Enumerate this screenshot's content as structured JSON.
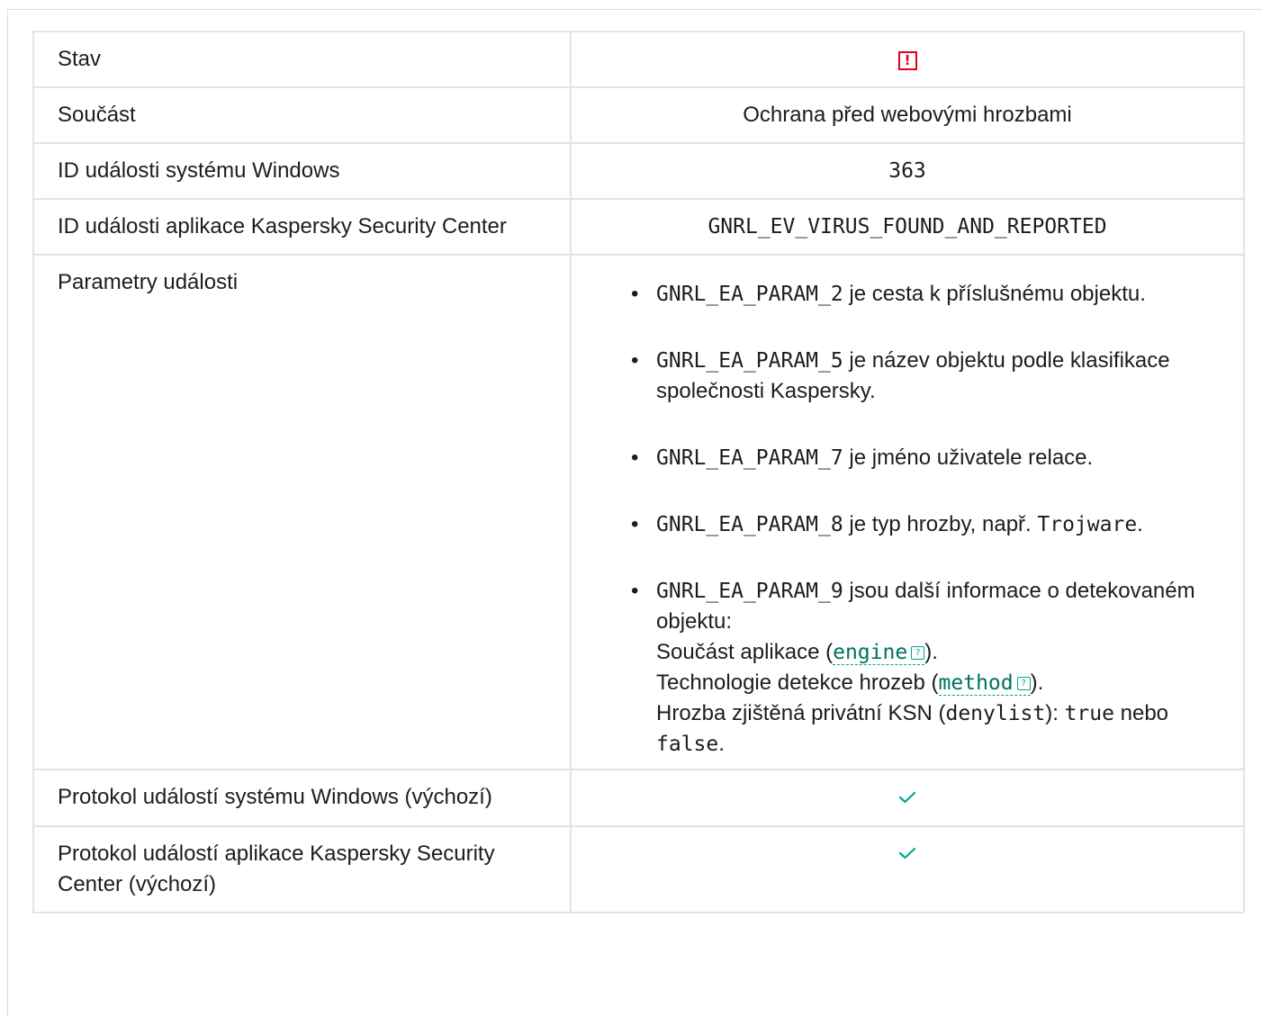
{
  "rows": {
    "status": {
      "label": "Stav",
      "icon": "warning-icon",
      "icon_glyph": "!"
    },
    "component": {
      "label": "Součást",
      "value": "Ochrana před webovými hrozbami"
    },
    "windows_event_id": {
      "label": "ID události systému Windows",
      "value": "363"
    },
    "ksc_event_id": {
      "label": "ID události aplikace Kaspersky Security Center",
      "value": "GNRL_EV_VIRUS_FOUND_AND_REPORTED"
    },
    "params": {
      "label": "Parametry události",
      "items": [
        {
          "code": "GNRL_EA_PARAM_2",
          "text": " je cesta k příslušnému objektu."
        },
        {
          "code": "GNRL_EA_PARAM_5",
          "text": " je název objektu podle klasifikace společnosti Kaspersky."
        },
        {
          "code": "GNRL_EA_PARAM_7",
          "text": " je jméno uživatele relace."
        },
        {
          "code": "GNRL_EA_PARAM_8",
          "text": " je typ hrozby, např. ",
          "code2": "Trojware",
          "text2": "."
        },
        {
          "code": "GNRL_EA_PARAM_9",
          "text": " jsou další informace o detekovaném objektu:",
          "line1_pre": "Součást aplikace (",
          "line1_term": "engine",
          "line1_post": ").",
          "line2_pre": "Technologie detekce hrozeb (",
          "line2_term": "method",
          "line2_post": ").",
          "line3_pre": "Hrozba zjištěná privátní KSN (",
          "line3_code": "denylist",
          "line3_mid": "): ",
          "line3_true": "true",
          "line3_or": " nebo ",
          "line3_false": "false",
          "line3_end": "."
        }
      ]
    },
    "windows_log": {
      "label": "Protokol událostí systému Windows (výchozí)",
      "icon": "checkmark-icon"
    },
    "ksc_log": {
      "label": "Protokol událostí aplikace Kaspersky Security Center (výchozí)",
      "icon": "checkmark-icon"
    }
  },
  "colors": {
    "accent": "#00a88e",
    "link": "#00715e",
    "warning": "#e3001b",
    "border": "#e3e3e3"
  }
}
